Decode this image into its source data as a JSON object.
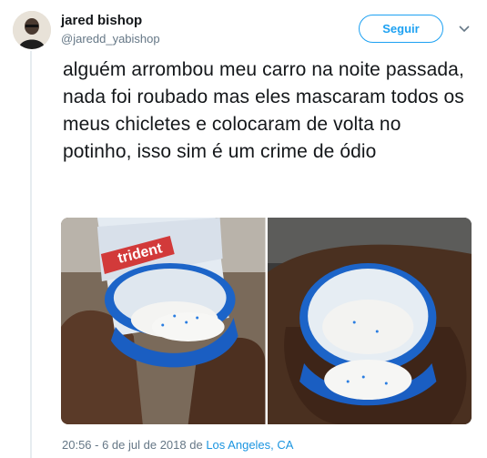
{
  "author": {
    "name": "jared bishop",
    "handle": "@jaredd_yabishop"
  },
  "follow_label": "Seguir",
  "tweet_text": "alguém arrombou meu carro na noite passada, nada foi roubado mas eles mascaram todos os meus chicletes e colocaram de volta no potinho, isso sim é um crime de ódio",
  "meta": {
    "timestamp": "20:56 - 6 de jul de 2018",
    "location_prefix": "de",
    "location": "Los Angeles, CA"
  },
  "photo_brand_text": "trident",
  "colors": {
    "accent": "#1da1f2",
    "secondary_text": "#657786",
    "link": "#1b95e0"
  },
  "icons": {
    "more": "chevron-down-icon"
  }
}
